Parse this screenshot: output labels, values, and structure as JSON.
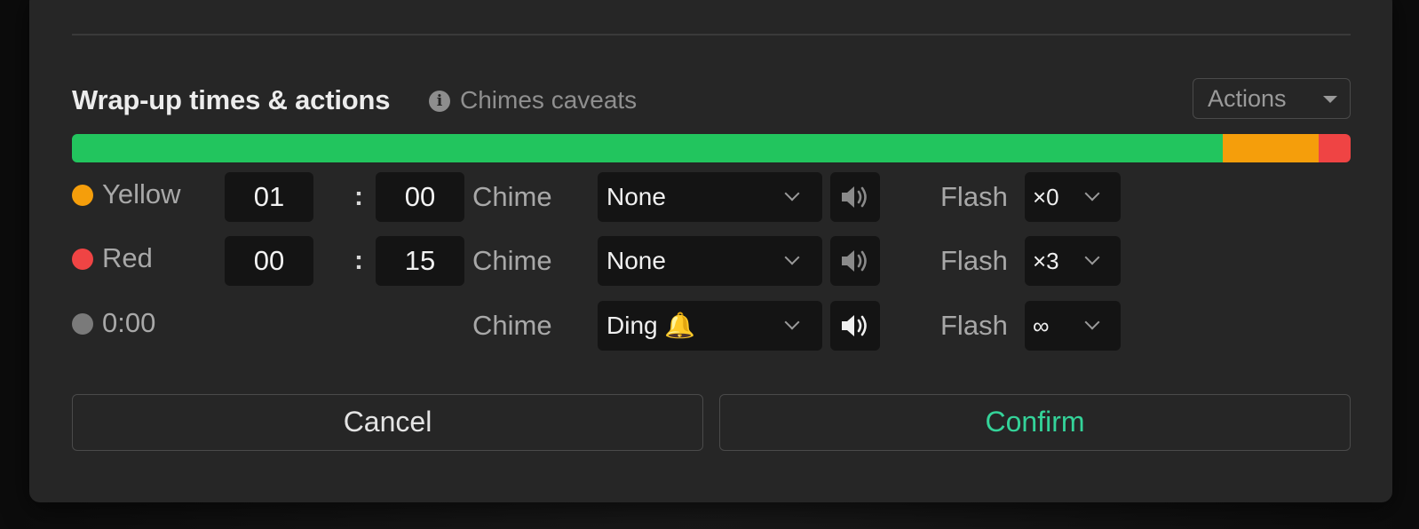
{
  "section": {
    "title": "Wrap-up times & actions",
    "caveats_label": "Chimes caveats",
    "info_glyph": "i"
  },
  "actions_dropdown": {
    "label": "Actions"
  },
  "timeline": {
    "segments": [
      {
        "name": "green",
        "color": "#22c55e",
        "fraction": 0.9
      },
      {
        "name": "yellow",
        "color": "#f59e0b",
        "fraction": 0.075
      },
      {
        "name": "red",
        "color": "#ef4444",
        "fraction": 0.025
      }
    ]
  },
  "rows": [
    {
      "label": "Yellow",
      "dot_color": "#f59e0b",
      "minutes": "01",
      "seconds": "00",
      "colon": ":",
      "chime_label": "Chime",
      "chime_value": "None",
      "speaker_color": "#8a8a8a",
      "flash_label": "Flash",
      "flash_value": "×0"
    },
    {
      "label": "Red",
      "dot_color": "#ef4444",
      "minutes": "00",
      "seconds": "15",
      "colon": ":",
      "chime_label": "Chime",
      "chime_value": "None",
      "speaker_color": "#8a8a8a",
      "flash_label": "Flash",
      "flash_value": "×3"
    },
    {
      "label": "0:00",
      "dot_color": "#7a7a7a",
      "chime_label": "Chime",
      "chime_value": "Ding 🔔",
      "speaker_color": "#f0f0f0",
      "flash_label": "Flash",
      "flash_value": "∞"
    }
  ],
  "footer": {
    "cancel_label": "Cancel",
    "confirm_label": "Confirm"
  },
  "colors": {
    "confirm_text": "#34d399",
    "modal_bg": "#262626",
    "field_bg": "#141414"
  }
}
